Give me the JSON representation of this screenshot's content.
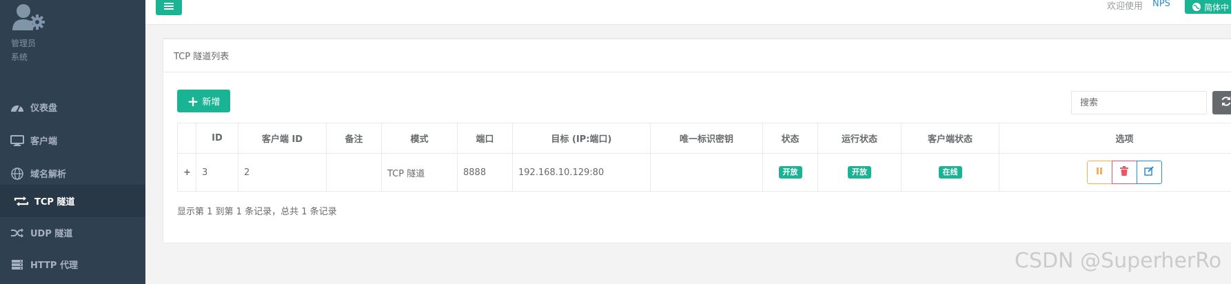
{
  "sidebar": {
    "profile_name": "管理员",
    "profile_role": "系统",
    "items": [
      {
        "label": "仪表盘",
        "icon": "dashboard-icon"
      },
      {
        "label": "客户端",
        "icon": "desktop-icon"
      },
      {
        "label": "域名解析",
        "icon": "globe-icon"
      },
      {
        "label": "TCP 隧道",
        "icon": "exchange-icon",
        "active": true
      },
      {
        "label": "UDP 隧道",
        "icon": "random-icon"
      },
      {
        "label": "HTTP 代理",
        "icon": "server-icon"
      }
    ]
  },
  "topbar": {
    "welcome": "欢迎使用",
    "user": "NPS",
    "lang": "简体中"
  },
  "panel": {
    "title": "TCP 隧道列表",
    "add_label": "新增",
    "search_placeholder": "搜索"
  },
  "table": {
    "headers": [
      "",
      "ID",
      "客户端 ID",
      "备注",
      "模式",
      "端口",
      "目标 (IP:端口)",
      "唯一标识密钥",
      "状态",
      "运行状态",
      "客户端状态",
      "选项"
    ],
    "rows": [
      {
        "expand": "+",
        "id": "3",
        "client_id": "2",
        "remark": "",
        "mode": "TCP 隧道",
        "port": "8888",
        "target": "192.168.10.129:80",
        "key": "",
        "status": "开放",
        "run_status": "开放",
        "client_status": "在线"
      }
    ]
  },
  "pagination_info": "显示第 1 到第 1 条记录，总共 1 条记录",
  "watermark": "CSDN @SuperherRo",
  "colors": {
    "sidebar_bg": "#2f4050",
    "primary": "#1ab394",
    "warning": "#f8ac59",
    "danger": "#ed5565",
    "info": "#2a8bd8"
  }
}
